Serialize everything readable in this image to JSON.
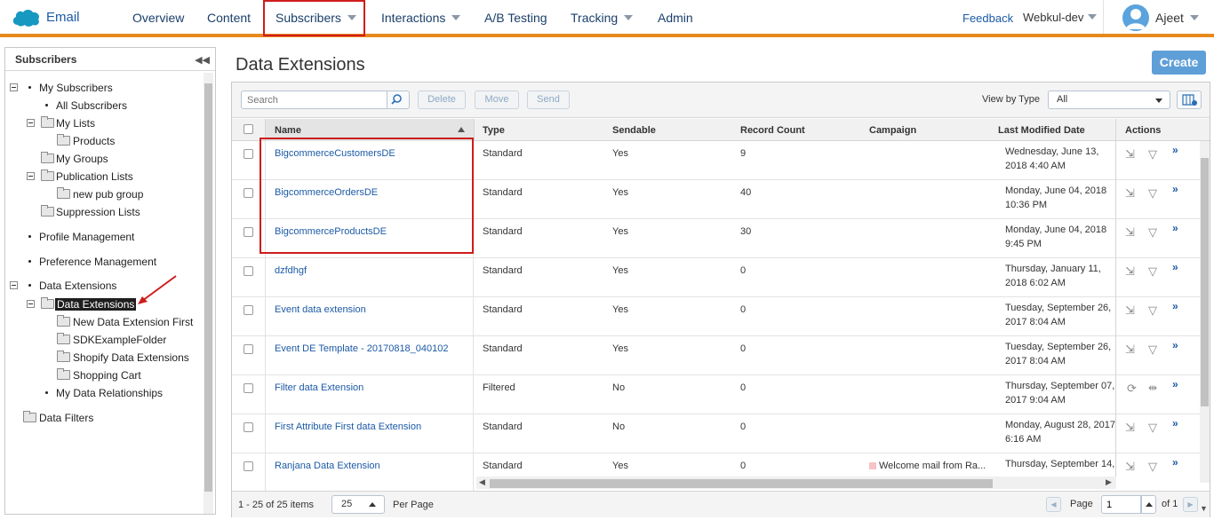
{
  "app": {
    "name": "Email"
  },
  "nav": {
    "items": [
      {
        "label": "Overview"
      },
      {
        "label": "Content"
      },
      {
        "label": "Subscribers"
      },
      {
        "label": "Interactions"
      },
      {
        "label": "A/B Testing"
      },
      {
        "label": "Tracking"
      },
      {
        "label": "Admin"
      }
    ],
    "feedback": "Feedback",
    "org": "Webkul-dev",
    "user": "Ajeet"
  },
  "colors": {
    "accent": "#e8891e",
    "link": "#1c5aa6",
    "highlight_box": "#cf1c1c",
    "create_button": "#5f9fd8"
  },
  "sidebar": {
    "title": "Subscribers",
    "tree": [
      {
        "label": "My Subscribers",
        "icon": "bullet",
        "expander": true
      },
      {
        "label": "All Subscribers",
        "icon": "bullet"
      },
      {
        "label": "My Lists",
        "icon": "folder-icon",
        "expander": true
      },
      {
        "label": "Products",
        "icon": "folder-icon"
      },
      {
        "label": "My Groups",
        "icon": "folder-icon"
      },
      {
        "label": "Publication Lists",
        "icon": "folder-icon",
        "expander": true
      },
      {
        "label": "new pub group",
        "icon": "folder-icon"
      },
      {
        "label": "Suppression Lists",
        "icon": "folder-icon"
      },
      {
        "label": "Profile Management",
        "icon": "bullet"
      },
      {
        "label": "Preference Management",
        "icon": "bullet"
      },
      {
        "label": "Data Extensions",
        "icon": "bullet",
        "expander": true
      },
      {
        "label": "Data Extensions",
        "icon": "folder-icon",
        "expander": true,
        "selected": true
      },
      {
        "label": "New Data Extension First",
        "icon": "folder-icon"
      },
      {
        "label": "SDKExampleFolder",
        "icon": "folder-icon"
      },
      {
        "label": "Shopify Data Extensions",
        "icon": "folder-icon"
      },
      {
        "label": "Shopping Cart",
        "icon": "folder-icon"
      },
      {
        "label": "My Data Relationships",
        "icon": "bullet"
      },
      {
        "label": "Data Filters",
        "icon": "folder-icon"
      }
    ]
  },
  "main": {
    "title": "Data Extensions",
    "create_label": "Create",
    "toolbar": {
      "search_placeholder": "Search",
      "delete_label": "Delete",
      "move_label": "Move",
      "send_label": "Send",
      "view_by_label": "View by Type",
      "view_by_value": "All"
    },
    "columns": [
      "Name",
      "Type",
      "Sendable",
      "Record Count",
      "Campaign",
      "Last Modified Date",
      "Actions"
    ],
    "rows": [
      {
        "name": "BigcommerceCustomersDE",
        "type": "Standard",
        "sendable": "Yes",
        "count": "9",
        "campaign": "",
        "date": "Wednesday, June 13, 2018 4:40 AM"
      },
      {
        "name": "BigcommerceOrdersDE",
        "type": "Standard",
        "sendable": "Yes",
        "count": "40",
        "campaign": "",
        "date": "Monday, June 04, 2018 10:36 PM"
      },
      {
        "name": "BigcommerceProductsDE",
        "type": "Standard",
        "sendable": "Yes",
        "count": "30",
        "campaign": "",
        "date": "Monday, June 04, 2018 9:45 PM"
      },
      {
        "name": "dzfdhgf",
        "type": "Standard",
        "sendable": "Yes",
        "count": "0",
        "campaign": "",
        "date": "Thursday, January 11, 2018 6:02 AM"
      },
      {
        "name": "Event data extension",
        "type": "Standard",
        "sendable": "Yes",
        "count": "0",
        "campaign": "",
        "date": "Tuesday, September 26, 2017 8:04 AM"
      },
      {
        "name": "Event DE Template - 20170818_040102",
        "type": "Standard",
        "sendable": "Yes",
        "count": "0",
        "campaign": "",
        "date": "Tuesday, September 26, 2017 8:04 AM"
      },
      {
        "name": "Filter data Extension",
        "type": "Filtered",
        "sendable": "No",
        "count": "0",
        "campaign": "",
        "date": "Thursday, September 07, 2017 9:04 AM"
      },
      {
        "name": "First Attribute First data Extension",
        "type": "Standard",
        "sendable": "No",
        "count": "0",
        "campaign": "",
        "date": "Monday, August 28, 2017 6:16 AM"
      },
      {
        "name": "Ranjana Data Extension",
        "type": "Standard",
        "sendable": "Yes",
        "count": "0",
        "campaign": "Welcome mail from Ra...",
        "date": "Thursday, September 14,"
      }
    ],
    "footer": {
      "items_count": "1 - 25 of 25 items",
      "per_page_value": "25",
      "per_page_label": "Per Page",
      "page_label": "Page",
      "page_value": "1",
      "of_label": "of 1"
    }
  }
}
